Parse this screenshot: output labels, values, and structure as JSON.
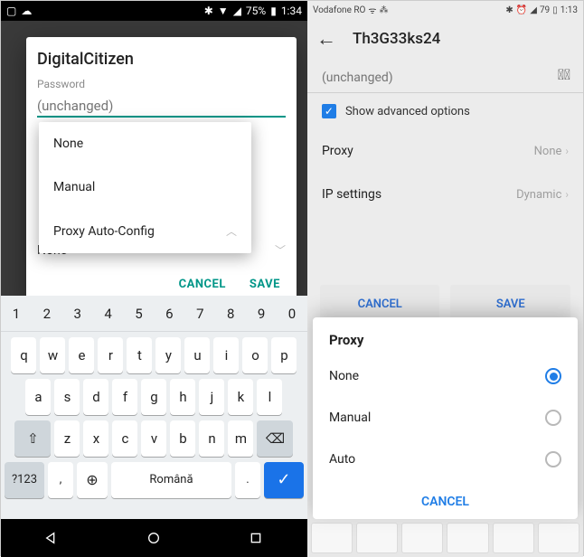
{
  "left": {
    "statusbar": {
      "battery_pct": "75%",
      "time": "1:34"
    },
    "dialog": {
      "title": "DigitalCitizen",
      "password_label": "Password",
      "password_placeholder": "(unchanged)",
      "proxy_menu": [
        "None",
        "Manual",
        "Proxy Auto-Config"
      ],
      "none_row": "None",
      "cancel": "CANCEL",
      "save": "SAVE"
    },
    "keyboard": {
      "numbers": [
        "1",
        "2",
        "3",
        "4",
        "5",
        "6",
        "7",
        "8",
        "9",
        "0"
      ],
      "row1": [
        "q",
        "w",
        "e",
        "r",
        "t",
        "y",
        "u",
        "i",
        "o",
        "p"
      ],
      "row2": [
        "a",
        "s",
        "d",
        "f",
        "g",
        "h",
        "j",
        "k",
        "l"
      ],
      "row3": [
        "z",
        "x",
        "c",
        "v",
        "b",
        "n",
        "m"
      ],
      "shift": "⇧",
      "backspace": "⌫",
      "sym": "?123",
      "comma": ",",
      "globe": "⊕",
      "space": "Română",
      "dot": ".",
      "enter": "✓"
    }
  },
  "right": {
    "statusbar": {
      "carrier": "Vodafone RO",
      "battery_pct": "79",
      "time": "1:13"
    },
    "header": {
      "title": "Th3G33ks24"
    },
    "password_placeholder": "(unchanged)",
    "advanced_label": "Show advanced options",
    "rows": {
      "proxy": {
        "label": "Proxy",
        "value": "None"
      },
      "ip": {
        "label": "IP settings",
        "value": "Dynamic"
      }
    },
    "buttons": {
      "cancel": "CANCEL",
      "save": "SAVE"
    },
    "sheet": {
      "title": "Proxy",
      "options": [
        "None",
        "Manual",
        "Auto"
      ],
      "selected_index": 0,
      "cancel": "CANCEL"
    }
  }
}
